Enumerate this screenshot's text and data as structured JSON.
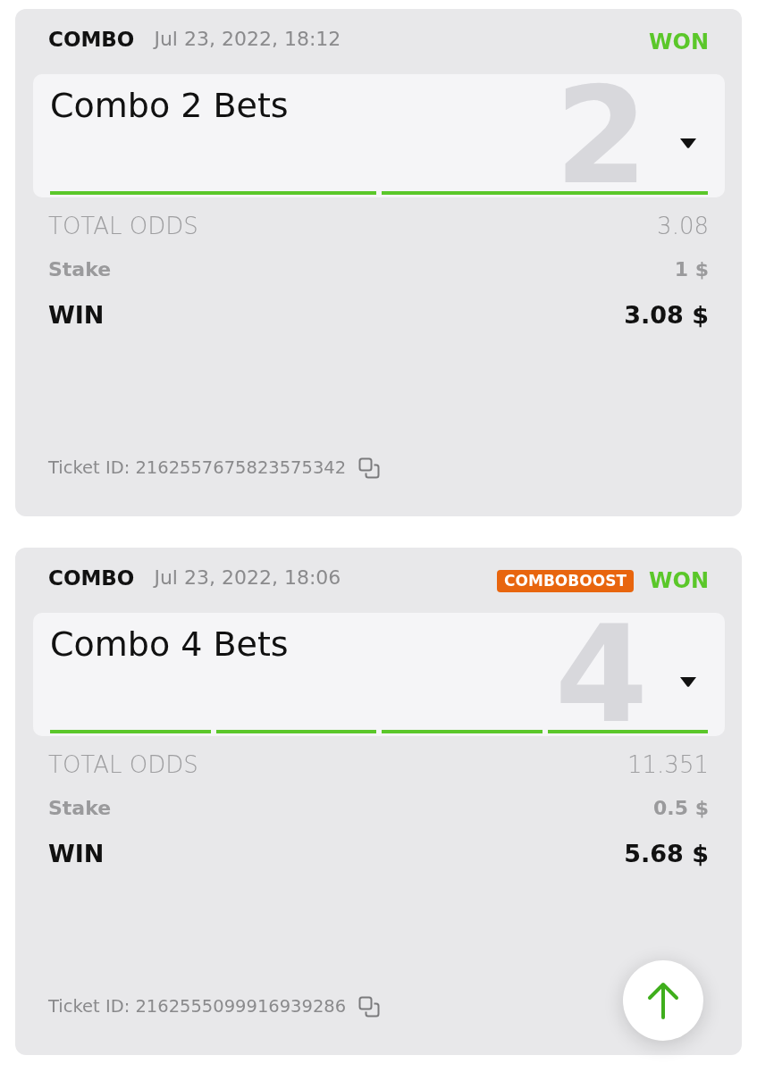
{
  "tickets": [
    {
      "bet_type": "COMBO",
      "date": "Jul 23, 2022, 18:12",
      "status": {
        "label": "WON",
        "kind": "won"
      },
      "title": "Combo 2 Bets",
      "leg_count": "2",
      "expanded": false,
      "legs": [
        {
          "won": true
        },
        {
          "won": true
        }
      ],
      "total_odds": {
        "label": "TOTAL ODDS",
        "value": "3.08"
      },
      "stake": {
        "label": "Stake",
        "value": "1 $"
      },
      "win": {
        "label": "WIN",
        "value": "3.08 $"
      },
      "ticket_id": "Ticket ID: 2162557675823575342"
    },
    {
      "bet_type": "COMBO",
      "date": "Jul 23, 2022, 18:06",
      "badge": "COMBOBOOST",
      "status": {
        "label": "WON",
        "kind": "won"
      },
      "title": "Combo 4 Bets",
      "leg_count": "4",
      "expanded": false,
      "legs": [
        {
          "won": true
        },
        {
          "won": true
        },
        {
          "won": true
        },
        {
          "won": true
        }
      ],
      "total_odds": {
        "label": "TOTAL ODDS",
        "value": "11.351"
      },
      "stake": {
        "label": "Stake",
        "value": "0.5 $"
      },
      "win": {
        "label": "WIN",
        "value": "5.68 $"
      },
      "ticket_id": "Ticket ID: 2162555099916939286"
    }
  ]
}
